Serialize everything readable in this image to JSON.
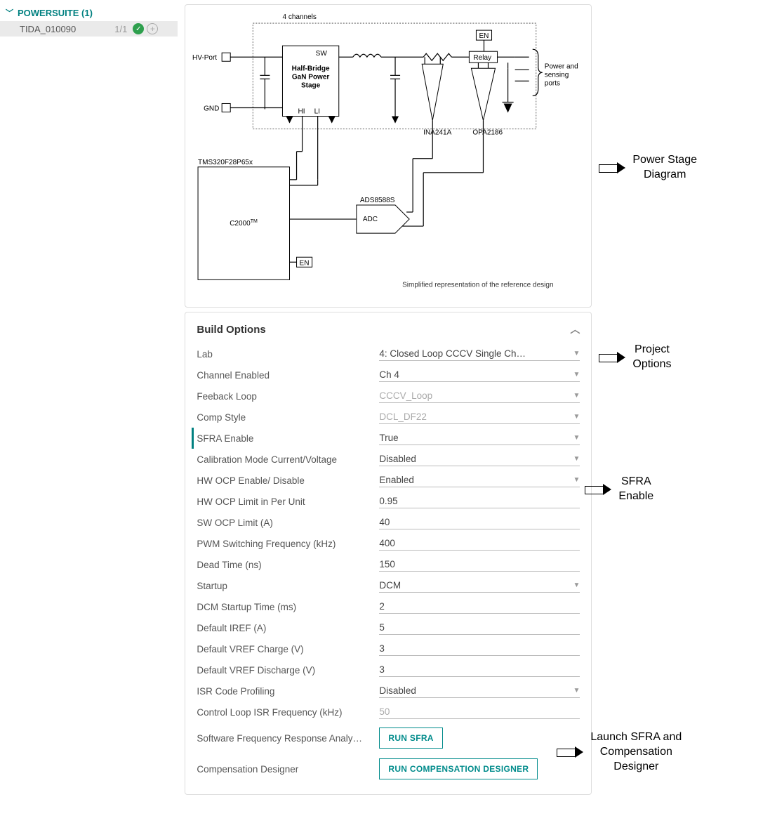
{
  "sidebar": {
    "header": "POWERSUITE (1)",
    "item": {
      "name": "TIDA_010090",
      "count": "1/1"
    }
  },
  "diagram": {
    "channels": "4 channels",
    "hv_port": "HV-Port",
    "gnd": "GND",
    "sw": "SW",
    "power_stage": "Half-Bridge GaN Power Stage",
    "hi": "HI",
    "li": "LI",
    "en": "EN",
    "relay": "Relay",
    "ports": "Power and sensing ports",
    "ina": "INA241A",
    "opa": "OPA2186",
    "mcu_part": "TMS320F28P65x",
    "mcu_name": "C2000",
    "tm": "TM",
    "adc_part": "ADS8588S",
    "adc": "ADC",
    "caption": "Simplified representation of the reference design"
  },
  "build": {
    "title": "Build Options",
    "rows": {
      "lab": {
        "label": "Lab",
        "value": "4: Closed Loop CCCV Single Ch…"
      },
      "channel": {
        "label": "Channel Enabled",
        "value": "Ch 4"
      },
      "feedback": {
        "label": "Feeback Loop",
        "value": "CCCV_Loop"
      },
      "comp": {
        "label": "Comp Style",
        "value": "DCL_DF22"
      },
      "sfra": {
        "label": "SFRA Enable",
        "value": "True"
      },
      "cal": {
        "label": "Calibration Mode Current/Voltage",
        "value": "Disabled"
      },
      "hwocp": {
        "label": "HW OCP Enable/ Disable",
        "value": "Enabled"
      },
      "hwocp_limit": {
        "label": "HW OCP Limit in Per Unit",
        "value": "0.95"
      },
      "swocp": {
        "label": "SW OCP Limit (A)",
        "value": "40"
      },
      "pwm": {
        "label": "PWM Switching Frequency (kHz)",
        "value": "400"
      },
      "dead": {
        "label": "Dead Time (ns)",
        "value": "150"
      },
      "startup": {
        "label": "Startup",
        "value": "DCM"
      },
      "dcm": {
        "label": "DCM Startup Time (ms)",
        "value": "2"
      },
      "iref": {
        "label": "Default IREF (A)",
        "value": "5"
      },
      "vrefc": {
        "label": "Default VREF Charge (V)",
        "value": "3"
      },
      "vrefd": {
        "label": "Default VREF Discharge (V)",
        "value": "3"
      },
      "isr": {
        "label": "ISR Code Profiling",
        "value": "Disabled"
      },
      "ctrl": {
        "label": "Control Loop ISR Frequency (kHz)",
        "value": "50"
      },
      "sfra_run": {
        "label": "Software Frequency Response Analy…",
        "button": "RUN SFRA"
      },
      "compdes": {
        "label": "Compensation Designer",
        "button": "RUN COMPENSATION DESIGNER"
      }
    }
  },
  "annotations": {
    "diagram": "Power Stage Diagram",
    "project": "Project Options",
    "sfra": "SFRA Enable",
    "launch": "Launch SFRA and Compensation Designer"
  }
}
